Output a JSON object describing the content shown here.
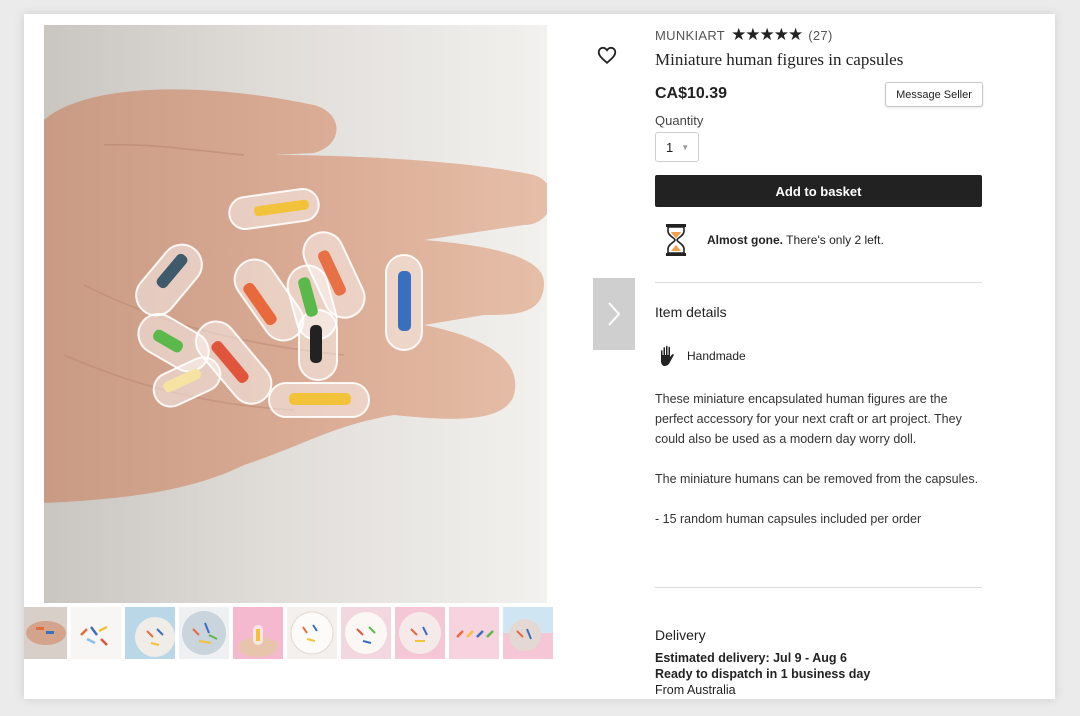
{
  "shop": {
    "name": "MUNKIART",
    "stars": "★★★★★",
    "review_count": "(27)"
  },
  "product": {
    "title": "Miniature human figures in capsules",
    "price": "CA$10.39",
    "message_seller_label": "Message Seller",
    "quantity_label": "Quantity",
    "quantity_value": "1",
    "add_to_basket_label": "Add to basket",
    "scarcity_bold": "Almost gone.",
    "scarcity_rest": " There's only 2 left."
  },
  "item_details": {
    "heading": "Item details",
    "handmade_label": "Handmade",
    "description": [
      "These miniature encapsulated human figures are the perfect accessory for your next craft or art project. They could also be used as a modern day worry doll.",
      "The miniature humans can be removed from the capsules.",
      "- 15 random human capsules included per order"
    ]
  },
  "delivery": {
    "heading": "Delivery",
    "estimated": "Estimated delivery: Jul 9 - Aug 6",
    "dispatch": "Ready to dispatch in 1 business day",
    "origin": "From Australia"
  },
  "icons": {
    "favorite": "heart-icon",
    "next": "chevron-right-icon",
    "scarcity": "hourglass-icon",
    "handmade": "hand-icon"
  },
  "colors": {
    "button_bg": "#222222",
    "hourglass_sand": "#f0a04b"
  }
}
